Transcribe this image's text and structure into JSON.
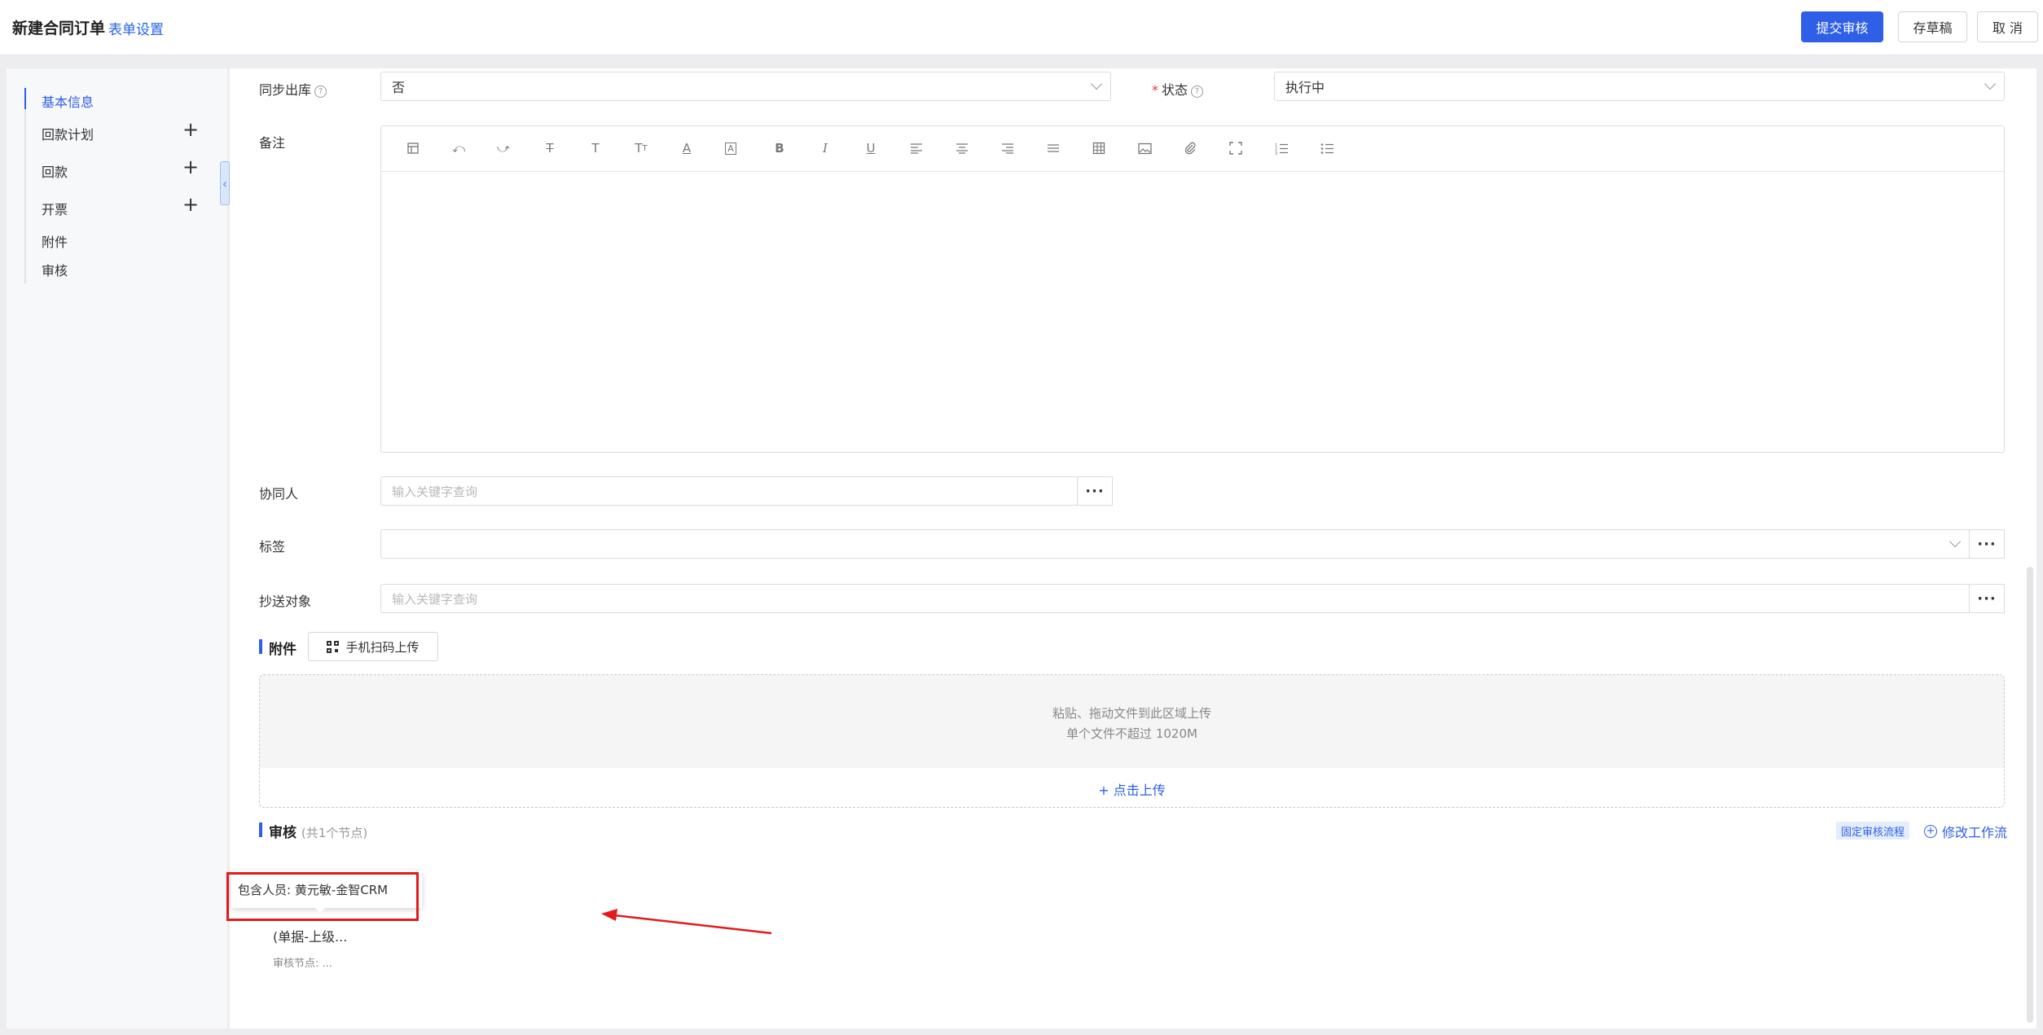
{
  "header": {
    "title": "新建合同订单",
    "form_settings": "表单设置",
    "submit_label": "提交审核",
    "draft_label": "存草稿",
    "cancel_label": "取 消"
  },
  "sidebar": {
    "items": [
      {
        "label": "基本信息",
        "active": true
      },
      {
        "label": "回款计划",
        "plus": "+"
      },
      {
        "label": "回款",
        "plus": "+"
      },
      {
        "label": "开票",
        "plus": "+"
      },
      {
        "label": "附件"
      },
      {
        "label": "审核"
      }
    ],
    "collapse_icon": "‹"
  },
  "form": {
    "sync_label": "同步出库",
    "sync_value": "否",
    "status_label": "状态",
    "status_value": "执行中",
    "required_mark": "*",
    "help_icon": "?",
    "remarks_label": "备注",
    "collaborator_label": "协同人",
    "collaborator_placeholder": "输入关键字查询",
    "tags_label": "标签",
    "cc_label": "抄送对象",
    "cc_placeholder": "输入关键字查询",
    "more_icon": "···"
  },
  "attachment": {
    "title": "附件",
    "scan_button": "手机扫码上传",
    "hint_line1": "粘贴、拖动文件到此区域上传",
    "hint_line2": "单个文件不超过 1020M",
    "click_upload": "+ 点击上传"
  },
  "review": {
    "title": "审核",
    "node_count": "(共1个节点)",
    "fixed_flow": "固定审核流程",
    "edit_flow": "修改工作流",
    "tooltip": "包含人员: 黄元敏-金智CRM",
    "node_text": "(单据-上级...",
    "node_sub": "审核节点: ..."
  },
  "colors": {
    "accent": "#2e5fe6",
    "annotation": "#e31b1b"
  }
}
